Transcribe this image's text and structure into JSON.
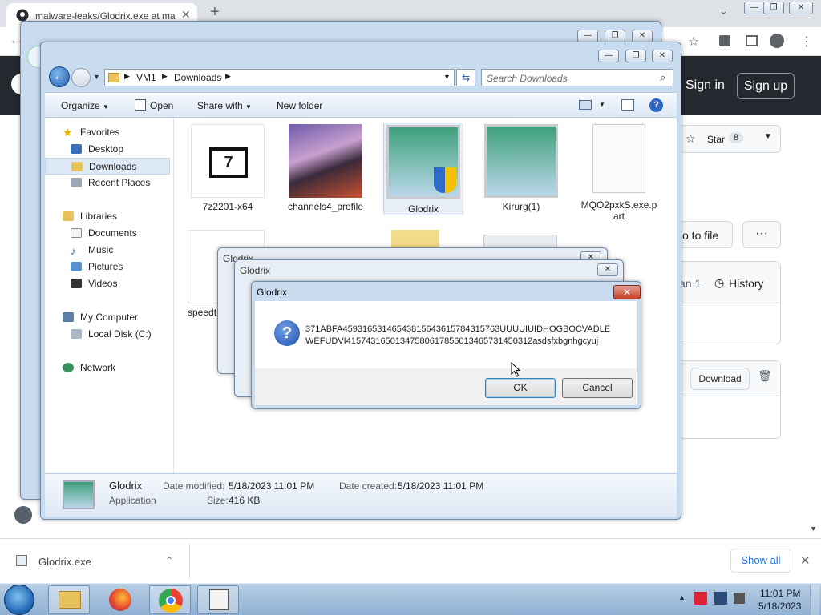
{
  "chrome": {
    "tab_title": "malware-leaks/Glodrix.exe at ma",
    "new_tab": "+",
    "gh_signin": "Sign in",
    "gh_signup": "Sign up",
    "star_label": "Star",
    "star_count": "8",
    "goto_file": "o to file",
    "more": "···",
    "history_partial": "an 1",
    "history": "History",
    "download_btn": "Download"
  },
  "download_bar": {
    "file": "Glodrix.exe",
    "show_all": "Show all"
  },
  "explorer": {
    "breadcrumb": [
      "VM1",
      "Downloads"
    ],
    "search_placeholder": "Search Downloads",
    "toolbar": {
      "organize": "Organize",
      "open": "Open",
      "share_with": "Share with",
      "new_folder": "New folder"
    },
    "sidebar": {
      "favorites": "Favorites",
      "fav_items": [
        "Desktop",
        "Downloads",
        "Recent Places"
      ],
      "libraries": "Libraries",
      "lib_items": [
        "Documents",
        "Music",
        "Pictures",
        "Videos"
      ],
      "computer": "My Computer",
      "disk": "Local Disk (C:)",
      "network": "Network"
    },
    "files": [
      "7z2201-x64",
      "channels4_profile",
      "Glodrix",
      "Kirurg(1)",
      "MQO2pxkS.exe.part"
    ],
    "partial_file": "speedt",
    "details": {
      "name": "Glodrix",
      "type": "Application",
      "modified_label": "Date modified:",
      "modified": "5/18/2023 11:01 PM",
      "created_label": "Date created:",
      "created": "5/18/2023 11:01 PM",
      "size_label": "Size:",
      "size": "416 KB"
    }
  },
  "dialog": {
    "title": "Glodrix",
    "back_title_1": "Glodrix",
    "back_title_2": "Glodrix",
    "line1": "371ABFA45931653146543815643615784315763UUUUIUIDHOGBOCVADLE",
    "line2": "WEFUDVI41574316501347580617856013465731450312asdsfxbgnhgcyuj",
    "ok": "OK",
    "cancel": "Cancel"
  },
  "taskbar": {
    "time": "11:01 PM",
    "date": "5/18/2023"
  }
}
